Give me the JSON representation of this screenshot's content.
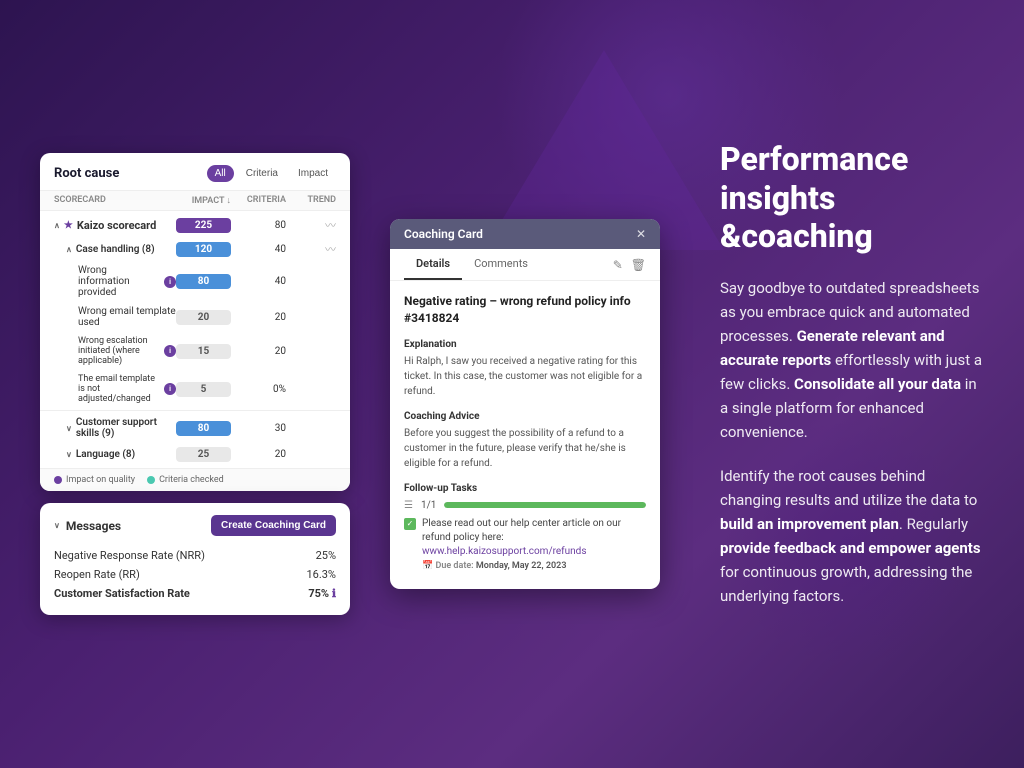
{
  "background": {
    "gradient": "purple"
  },
  "scorecard": {
    "title": "Root cause",
    "filters": [
      "All",
      "Criteria",
      "Impact"
    ],
    "active_filter": "All",
    "columns": {
      "scorecard": "SCORECARD",
      "impact": "IMPACT ↓",
      "criteria": "CRITERIA",
      "trend": "TREND"
    },
    "rows": [
      {
        "type": "parent",
        "label": "Kaizo scorecard",
        "impact": "225",
        "criteria": "80",
        "badge_type": "purple",
        "indent": 0
      },
      {
        "type": "parent",
        "label": "Case handling (8)",
        "impact": "120",
        "criteria": "40",
        "badge_type": "blue",
        "indent": 1
      },
      {
        "type": "child",
        "label": "Wrong information provided",
        "impact": "80",
        "criteria": "40",
        "badge_type": "blue",
        "indent": 2,
        "info": true
      },
      {
        "type": "child",
        "label": "Wrong email template used",
        "impact": "20",
        "criteria": "20",
        "badge_type": "gray",
        "indent": 2
      },
      {
        "type": "child",
        "label": "Wrong escalation initiated (where applicable)",
        "impact": "15",
        "criteria": "20",
        "badge_type": "gray",
        "indent": 2,
        "info": true
      },
      {
        "type": "child",
        "label": "The email template is not adjusted/changed",
        "impact": "5",
        "criteria": "0%",
        "badge_type": "gray",
        "indent": 2,
        "info": true
      },
      {
        "type": "parent",
        "label": "Customer support skills (9)",
        "impact": "80",
        "criteria": "30",
        "badge_type": "blue",
        "indent": 1
      },
      {
        "type": "parent",
        "label": "Language (8)",
        "impact": "25",
        "criteria": "20",
        "badge_type": "gray",
        "indent": 1
      }
    ],
    "legend": [
      {
        "label": "Impact on quality",
        "color": "purple"
      },
      {
        "label": "Criteria checked",
        "color": "teal"
      }
    ]
  },
  "messages": {
    "title": "Messages",
    "create_button": "Create Coaching Card",
    "rows": [
      {
        "label": "Negative Response Rate (NRR)",
        "value": "25%",
        "bold": false
      },
      {
        "label": "Reopen Rate (RR)",
        "value": "16.3%",
        "bold": false
      },
      {
        "label": "Customer Satisfaction Rate",
        "value": "75%",
        "bold": true
      }
    ]
  },
  "coaching_card": {
    "title": "Coaching Card",
    "tabs": [
      "Details",
      "Comments"
    ],
    "active_tab": "Details",
    "ticket_title": "Negative rating – wrong refund policy info #3418824",
    "explanation_label": "Explanation",
    "explanation_text": "Hi Ralph, I saw you received a negative rating for this ticket. In this case, the customer was not eligible for a refund.",
    "advice_label": "Coaching Advice",
    "advice_text": "Before you suggest the possibility of a refund to a customer in the future, please verify that he/she is eligible for a refund.",
    "followup_label": "Follow-up Tasks",
    "followup_progress": "1/1",
    "followup_items": [
      {
        "text": "Please read out our help center article on our refund policy here: www.help.kaizosupport.com/refunds",
        "url": "www.help.kaizosupport.com/refunds",
        "due_date": "Monday, May 22, 2023",
        "checked": true
      }
    ]
  },
  "right_panel": {
    "heading": "Performance insights\n&coaching",
    "paragraphs": [
      {
        "text": "Say goodbye to outdated spreadsheets as you embrace quick and automated processes. ",
        "bold": "Generate relevant and accurate reports",
        "after": " effortlessly with just a few clicks. ",
        "bold2": "Consolidate all your data",
        "after2": " in a single platform for enhanced convenience."
      },
      {
        "text": "Identify the root causes behind changing results and utilize the data to ",
        "bold": "build an improvement plan",
        "after": ". Regularly ",
        "bold2": "provide feedback and empower agents",
        "after2": " for continuous growth, addressing the underlying factors."
      }
    ]
  }
}
